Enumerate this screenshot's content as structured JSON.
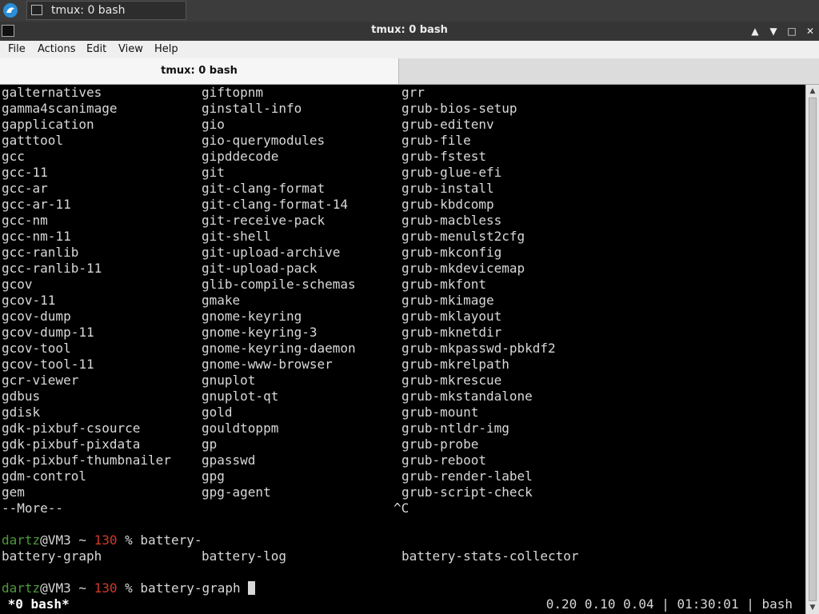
{
  "panel": {
    "taskbar_title": "tmux: 0 bash"
  },
  "window": {
    "title": "tmux: 0 bash"
  },
  "menu": [
    "File",
    "Actions",
    "Edit",
    "View",
    "Help"
  ],
  "tab": {
    "label": "tmux: 0 bash"
  },
  "terminal": {
    "rows": [
      [
        "galternatives",
        "giftopnm",
        "grr"
      ],
      [
        "gamma4scanimage",
        "ginstall-info",
        "grub-bios-setup"
      ],
      [
        "gapplication",
        "gio",
        "grub-editenv"
      ],
      [
        "gatttool",
        "gio-querymodules",
        "grub-file"
      ],
      [
        "gcc",
        "gipddecode",
        "grub-fstest"
      ],
      [
        "gcc-11",
        "git",
        "grub-glue-efi"
      ],
      [
        "gcc-ar",
        "git-clang-format",
        "grub-install"
      ],
      [
        "gcc-ar-11",
        "git-clang-format-14",
        "grub-kbdcomp"
      ],
      [
        "gcc-nm",
        "git-receive-pack",
        "grub-macbless"
      ],
      [
        "gcc-nm-11",
        "git-shell",
        "grub-menulst2cfg"
      ],
      [
        "gcc-ranlib",
        "git-upload-archive",
        "grub-mkconfig"
      ],
      [
        "gcc-ranlib-11",
        "git-upload-pack",
        "grub-mkdevicemap"
      ],
      [
        "gcov",
        "glib-compile-schemas",
        "grub-mkfont"
      ],
      [
        "gcov-11",
        "gmake",
        "grub-mkimage"
      ],
      [
        "gcov-dump",
        "gnome-keyring",
        "grub-mklayout"
      ],
      [
        "gcov-dump-11",
        "gnome-keyring-3",
        "grub-mknetdir"
      ],
      [
        "gcov-tool",
        "gnome-keyring-daemon",
        "grub-mkpasswd-pbkdf2"
      ],
      [
        "gcov-tool-11",
        "gnome-www-browser",
        "grub-mkrelpath"
      ],
      [
        "gcr-viewer",
        "gnuplot",
        "grub-mkrescue"
      ],
      [
        "gdbus",
        "gnuplot-qt",
        "grub-mkstandalone"
      ],
      [
        "gdisk",
        "gold",
        "grub-mount"
      ],
      [
        "gdk-pixbuf-csource",
        "gouldtoppm",
        "grub-ntldr-img"
      ],
      [
        "gdk-pixbuf-pixdata",
        "gp",
        "grub-probe"
      ],
      [
        "gdk-pixbuf-thumbnailer",
        "gpasswd",
        "grub-reboot"
      ],
      [
        "gdm-control",
        "gpg",
        "grub-render-label"
      ],
      [
        "gem",
        "gpg-agent",
        "grub-script-check"
      ]
    ],
    "more": "--More--",
    "interrupt": "^C",
    "prompt1": {
      "user": "dartz",
      "host": "@VM3 ~ ",
      "code": "130",
      "sym": " % ",
      "cmd": "battery-"
    },
    "completions": [
      "battery-graph",
      "battery-log",
      "battery-stats-collector"
    ],
    "prompt2": {
      "user": "dartz",
      "host": "@VM3 ~ ",
      "code": "130",
      "sym": " % ",
      "cmd": "battery-graph "
    },
    "status": {
      "left": " *0 bash*",
      "right": "0.20 0.10 0.04 | 01:30:01 | bash"
    }
  }
}
